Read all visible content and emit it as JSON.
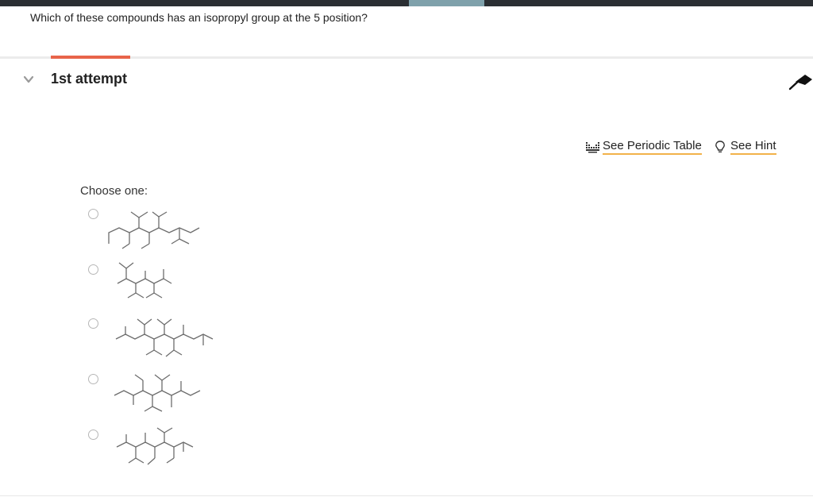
{
  "question": {
    "text": "Which of these compounds has an isopropyl group at the 5 position?"
  },
  "attempt": {
    "title": "1st attempt",
    "collapse_icon": "chevron-down-icon",
    "pin_icon": "pushpin-icon"
  },
  "tools": {
    "periodic_table": {
      "label": "See Periodic Table",
      "icon": "periodic-table-icon"
    },
    "hint": {
      "label": "See Hint",
      "icon": "lightbulb-icon"
    }
  },
  "choices": {
    "prompt": "Choose one:",
    "options": [
      {
        "id": "option-1",
        "selected": false
      },
      {
        "id": "option-2",
        "selected": false
      },
      {
        "id": "option-3",
        "selected": false
      },
      {
        "id": "option-4",
        "selected": false
      },
      {
        "id": "option-5",
        "selected": false
      }
    ]
  },
  "colors": {
    "accent": "#e8644a",
    "link_underline": "#f2b24a",
    "topbar": "#2b2f33",
    "topbar_tab": "#7fa1ab"
  }
}
